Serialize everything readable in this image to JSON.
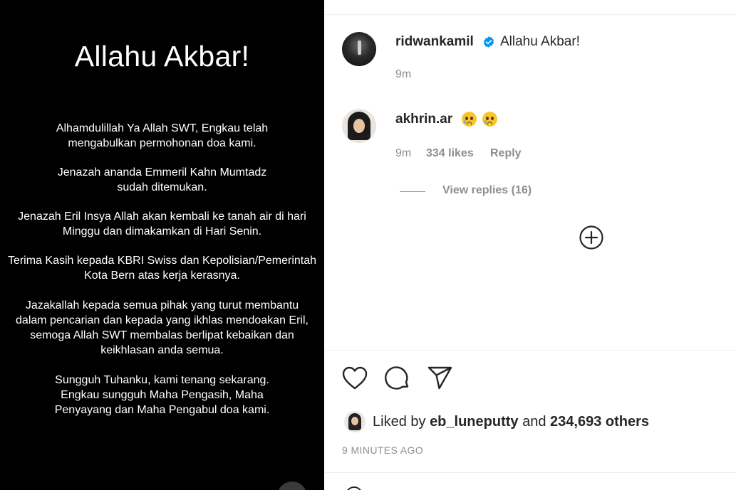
{
  "post": {
    "title": "Allahu Akbar!",
    "paragraphs": [
      [
        "Alhamdulillah Ya Allah SWT, Engkau telah",
        "mengabulkan permohonan doa kami."
      ],
      [
        "Jenazah ananda Emmeril Kahn Mumtadz",
        "sudah ditemukan."
      ],
      [
        "Jenazah Eril Insya Allah akan kembali ke tanah air di hari",
        "Minggu dan dimakamkan di Hari Senin."
      ],
      [
        "Terima Kasih kepada KBRI Swiss dan Kepolisian/Pemerintah",
        "Kota Bern atas kerja kerasnya."
      ],
      [
        "Jazakallah kepada semua pihak yang turut membantu",
        "dalam pencarian dan kepada yang ikhlas mendoakan Eril,",
        "semoga Allah SWT membalas berlipat kebaikan dan",
        "keikhlasan anda semua."
      ],
      [
        "Sungguh Tuhanku, kami tenang sekarang.",
        "Engkau sungguh Maha Pengasih, Maha",
        "Penyayang dan Maha Pengabul doa kami."
      ]
    ]
  },
  "caption": {
    "username": "ridwankamil",
    "verified": true,
    "text": "Allahu Akbar!",
    "time": "9m"
  },
  "comment": {
    "username": "akhrin.ar",
    "emojis": [
      "crying-face",
      "crying-face"
    ],
    "time": "9m",
    "likes": "334 likes",
    "reply_label": "Reply",
    "view_replies": "View replies (16)"
  },
  "actions": {
    "icons": [
      "heart-icon",
      "comment-icon",
      "share-icon"
    ]
  },
  "likes": {
    "prefix": "Liked by",
    "user": "eb_luneputty",
    "conjunction": "and",
    "others": "234,693 others"
  },
  "timestamp": "9 MINUTES AGO",
  "colors": {
    "text": "#262626",
    "secondary": "#8e8e8e",
    "verified": "#0095f6",
    "divider": "#efefef"
  }
}
